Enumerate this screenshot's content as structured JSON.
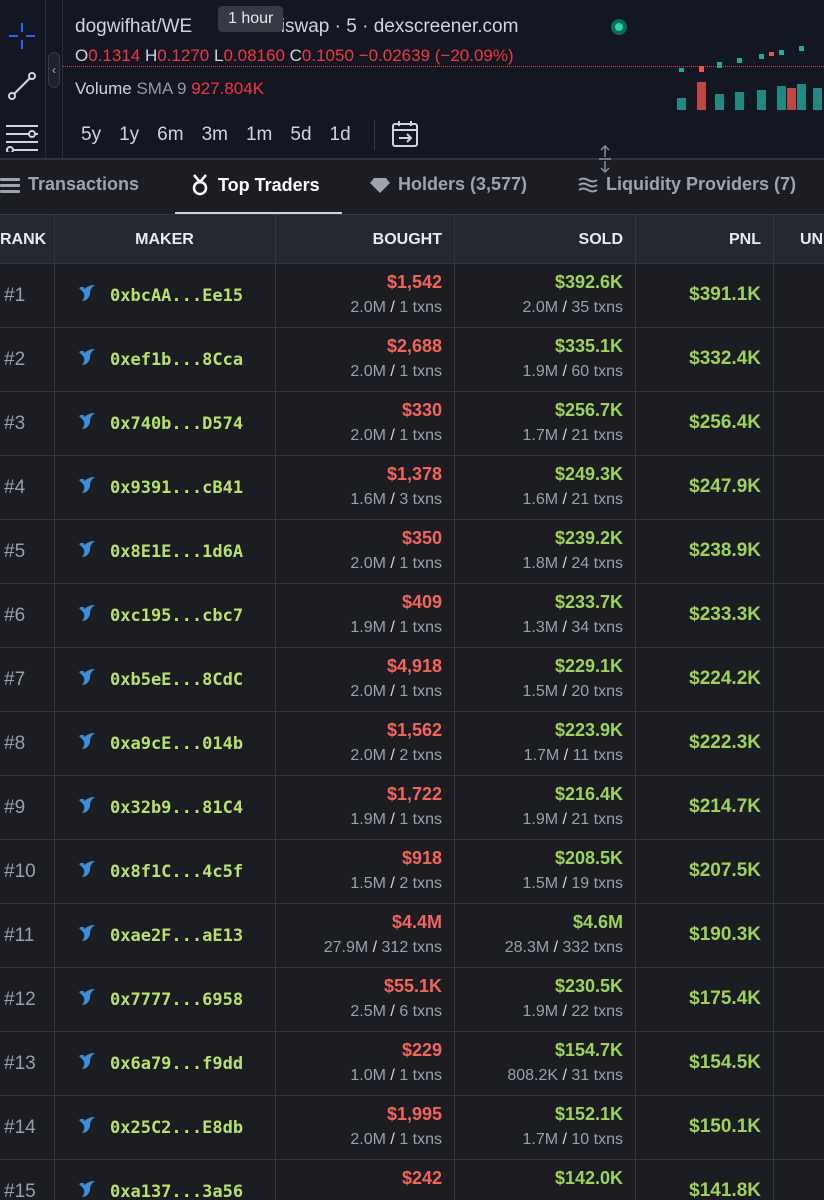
{
  "chart": {
    "title": "dogwifhat/WETH on Uniswap · 5 · dexscreener.com",
    "title_left": "dogwifhat/WE",
    "title_right": "niswap · 5 · dexscreener.com",
    "tooltip": "1 hour",
    "ohlc": {
      "o_label": "O",
      "o": "0.1314",
      "h_label": "H",
      "h": "0.1270",
      "l_label": "L",
      "l": "0.08160",
      "c_label": "C",
      "c": "0.1050",
      "change": "−0.02639 (−20.09%)"
    },
    "volume": {
      "label": "Volume",
      "sma": "SMA 9",
      "value": "927.804K"
    },
    "ranges": [
      "5y",
      "1y",
      "6m",
      "3m",
      "1m",
      "5d",
      "1d"
    ],
    "colors": {
      "up": "#26a69a",
      "down": "#ef5350"
    }
  },
  "tabs": [
    {
      "label": "Transactions",
      "icon": "list-icon"
    },
    {
      "label": "Top Traders",
      "icon": "medal-icon"
    },
    {
      "label": "Holders (3,577)",
      "icon": "diamond-icon"
    },
    {
      "label": "Liquidity Providers (7)",
      "icon": "waves-icon"
    }
  ],
  "table": {
    "headers": {
      "rank": "RANK",
      "maker": "MAKER",
      "bought": "BOUGHT",
      "sold": "SOLD",
      "pnl": "PNL",
      "un": "UN"
    },
    "rows": [
      {
        "rank": "#1",
        "maker": "0xbcAA...Ee15",
        "bought": "$1,542",
        "bought_tokens": "2.0M",
        "bought_txns": "1 txns",
        "sold": "$392.6K",
        "sold_tokens": "2.0M",
        "sold_txns": "35 txns",
        "pnl": "$391.1K"
      },
      {
        "rank": "#2",
        "maker": "0xef1b...8Cca",
        "bought": "$2,688",
        "bought_tokens": "2.0M",
        "bought_txns": "1 txns",
        "sold": "$335.1K",
        "sold_tokens": "1.9M",
        "sold_txns": "60 txns",
        "pnl": "$332.4K"
      },
      {
        "rank": "#3",
        "maker": "0x740b...D574",
        "bought": "$330",
        "bought_tokens": "2.0M",
        "bought_txns": "1 txns",
        "sold": "$256.7K",
        "sold_tokens": "1.7M",
        "sold_txns": "21 txns",
        "pnl": "$256.4K"
      },
      {
        "rank": "#4",
        "maker": "0x9391...cB41",
        "bought": "$1,378",
        "bought_tokens": "1.6M",
        "bought_txns": "3 txns",
        "sold": "$249.3K",
        "sold_tokens": "1.6M",
        "sold_txns": "21 txns",
        "pnl": "$247.9K"
      },
      {
        "rank": "#5",
        "maker": "0x8E1E...1d6A",
        "bought": "$350",
        "bought_tokens": "2.0M",
        "bought_txns": "1 txns",
        "sold": "$239.2K",
        "sold_tokens": "1.8M",
        "sold_txns": "24 txns",
        "pnl": "$238.9K"
      },
      {
        "rank": "#6",
        "maker": "0xc195...cbc7",
        "bought": "$409",
        "bought_tokens": "1.9M",
        "bought_txns": "1 txns",
        "sold": "$233.7K",
        "sold_tokens": "1.3M",
        "sold_txns": "34 txns",
        "pnl": "$233.3K"
      },
      {
        "rank": "#7",
        "maker": "0xb5eE...8CdC",
        "bought": "$4,918",
        "bought_tokens": "2.0M",
        "bought_txns": "1 txns",
        "sold": "$229.1K",
        "sold_tokens": "1.5M",
        "sold_txns": "20 txns",
        "pnl": "$224.2K"
      },
      {
        "rank": "#8",
        "maker": "0xa9cE...014b",
        "bought": "$1,562",
        "bought_tokens": "2.0M",
        "bought_txns": "2 txns",
        "sold": "$223.9K",
        "sold_tokens": "1.7M",
        "sold_txns": "11 txns",
        "pnl": "$222.3K"
      },
      {
        "rank": "#9",
        "maker": "0x32b9...81C4",
        "bought": "$1,722",
        "bought_tokens": "1.9M",
        "bought_txns": "1 txns",
        "sold": "$216.4K",
        "sold_tokens": "1.9M",
        "sold_txns": "21 txns",
        "pnl": "$214.7K"
      },
      {
        "rank": "#10",
        "maker": "0x8f1C...4c5f",
        "bought": "$918",
        "bought_tokens": "1.5M",
        "bought_txns": "2 txns",
        "sold": "$208.5K",
        "sold_tokens": "1.5M",
        "sold_txns": "19 txns",
        "pnl": "$207.5K"
      },
      {
        "rank": "#11",
        "maker": "0xae2F...aE13",
        "bought": "$4.4M",
        "bought_tokens": "27.9M",
        "bought_txns": "312 txns",
        "sold": "$4.6M",
        "sold_tokens": "28.3M",
        "sold_txns": "332 txns",
        "pnl": "$190.3K"
      },
      {
        "rank": "#12",
        "maker": "0x7777...6958",
        "bought": "$55.1K",
        "bought_tokens": "2.5M",
        "bought_txns": "6 txns",
        "sold": "$230.5K",
        "sold_tokens": "1.9M",
        "sold_txns": "22 txns",
        "pnl": "$175.4K"
      },
      {
        "rank": "#13",
        "maker": "0x6a79...f9dd",
        "bought": "$229",
        "bought_tokens": "1.0M",
        "bought_txns": "1 txns",
        "sold": "$154.7K",
        "sold_tokens": "808.2K",
        "sold_txns": "31 txns",
        "pnl": "$154.5K"
      },
      {
        "rank": "#14",
        "maker": "0x25C2...E8db",
        "bought": "$1,995",
        "bought_tokens": "2.0M",
        "bought_txns": "1 txns",
        "sold": "$152.1K",
        "sold_tokens": "1.7M",
        "sold_txns": "10 txns",
        "pnl": "$150.1K"
      },
      {
        "rank": "#15",
        "maker": "0xa137...3a56",
        "bought": "$242",
        "bought_tokens": "",
        "bought_txns": "",
        "sold": "$142.0K",
        "sold_tokens": "",
        "sold_txns": "",
        "pnl": "$141.8K"
      }
    ]
  }
}
